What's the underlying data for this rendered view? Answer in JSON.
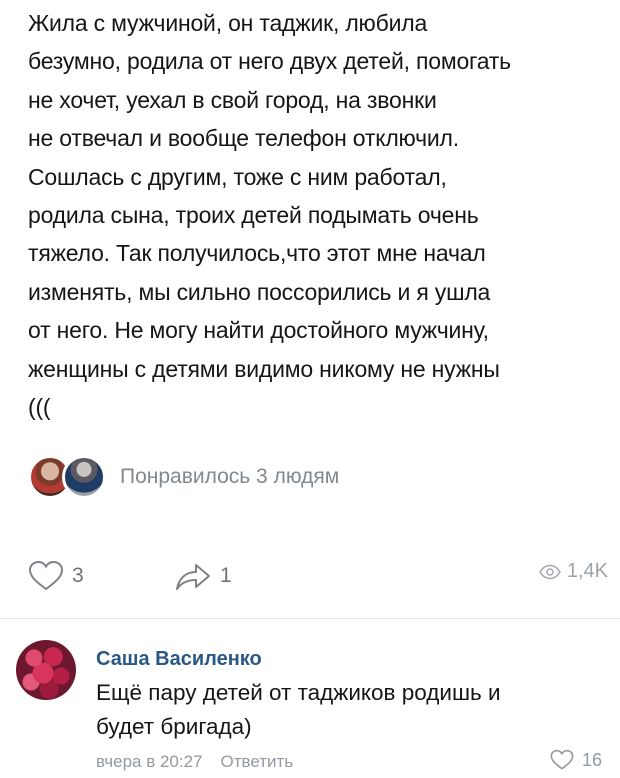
{
  "post": {
    "lines": [
      "Жила с мужчиной, он таджик, любила",
      "безумно, родила от него двух детей, помогать",
      "не хочет, уехал в свой город, на звонки",
      "не отвечал и вообще телефон отключил.",
      "Сошлась с другим, тоже с ним работал,",
      "родила сына, троих детей подымать очень",
      "тяжело. Так получилось,что этот мне начал",
      "изменять, мы сильно поссорились и я ушла",
      "от него. Не могу найти достойного мужчину,",
      "женщины с детями видимо никому не нужны",
      "((("
    ]
  },
  "likes": {
    "text": "Понравилось 3 людям"
  },
  "actions": {
    "likes": "3",
    "shares": "1",
    "views": "1,4K"
  },
  "comment": {
    "author": "Саша Василенко",
    "lines": [
      "Ещё пару детей от таджиков родишь и",
      "будет бригада)"
    ],
    "time": "вчера в 20:27",
    "reply": "Ответить",
    "likes": "16"
  },
  "icons": {
    "like": "heart-icon",
    "share": "share-arrow-icon",
    "views": "eye-icon",
    "comment_like": "heart-icon"
  }
}
